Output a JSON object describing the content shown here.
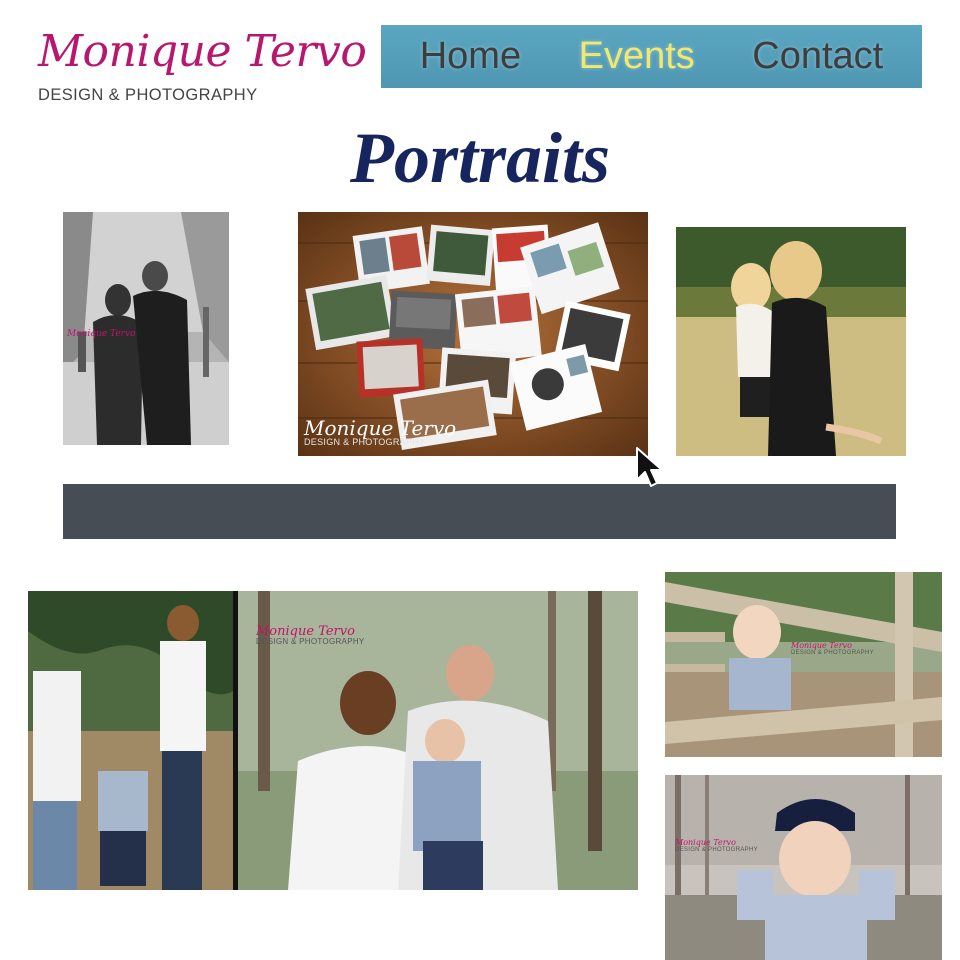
{
  "header": {
    "logo": {
      "name": "Monique Tervo",
      "tagline": "DESIGN & PHOTOGRAPHY"
    },
    "nav": [
      {
        "label": "Home",
        "active": false
      },
      {
        "label": "Events",
        "active": true
      },
      {
        "label": "Contact",
        "active": false
      }
    ],
    "accent_color": "#5aa6c1",
    "active_color": "#f2e86b"
  },
  "main": {
    "title": "Portraits",
    "title_color": "#16255e",
    "watermark": {
      "name": "Monique Tervo",
      "tagline": "DESIGN & PHOTOGRAPHY"
    },
    "banner_color": "#474d55"
  }
}
